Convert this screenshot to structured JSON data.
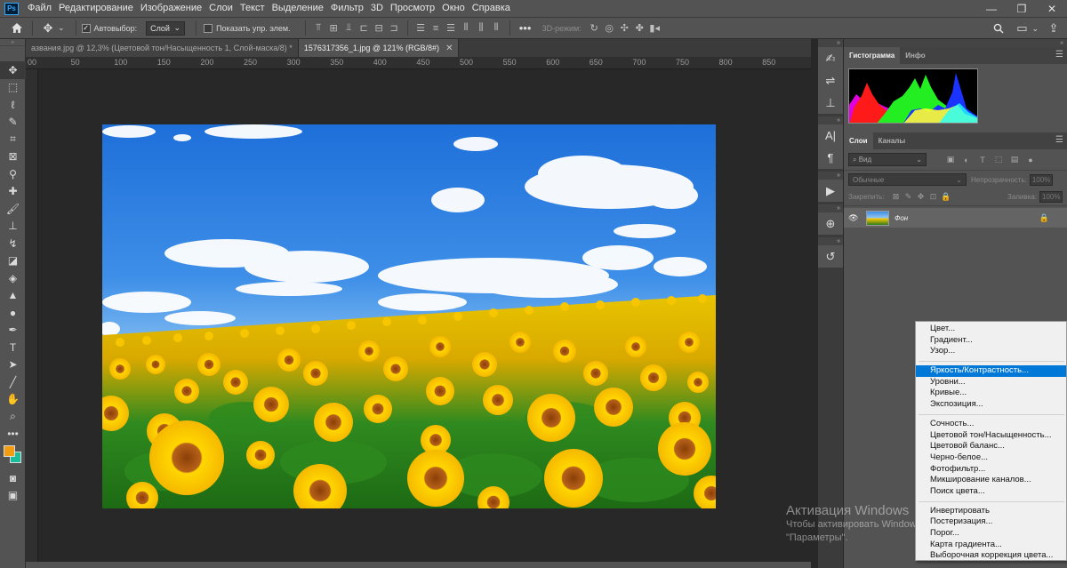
{
  "menubar": {
    "logo": "Ps",
    "items": [
      "Файл",
      "Редактирование",
      "Изображение",
      "Слои",
      "Текст",
      "Выделение",
      "Фильтр",
      "3D",
      "Просмотр",
      "Окно",
      "Справка"
    ],
    "window_controls": [
      "—",
      "❐",
      "✕"
    ]
  },
  "options": {
    "autoselect_label": "Автовыбор:",
    "autoselect_value": "Слой",
    "show_transform_label": "Показать упр. элем.",
    "mode_3d_label": "3D-режим:"
  },
  "tabs": [
    {
      "label": "азвания.jpg @ 12,3% (Цветовой тон/Насыщенность 1, Слой-маска/8) *",
      "active": false
    },
    {
      "label": "1576317356_1.jpg @ 121% (RGB/8#)",
      "active": true
    }
  ],
  "ruler": {
    "top_ticks": [
      "00",
      "50",
      "100",
      "150",
      "200",
      "250",
      "300",
      "350",
      "400",
      "450",
      "500",
      "550",
      "600",
      "650",
      "700",
      "750",
      "800",
      "850"
    ]
  },
  "panels": {
    "histogram_tabs": [
      "Гистограмма",
      "Инфо"
    ],
    "layers_tabs": [
      "Слои",
      "Каналы"
    ],
    "kind_placeholder": "Вид",
    "blend_mode": "Обычные",
    "opacity_label": "Непрозрачность:",
    "opacity_value": "100%",
    "lock_label": "Закрепить:",
    "fill_label": "Заливка:",
    "fill_value": "100%",
    "layer_name": "Фон"
  },
  "context_menu": {
    "groups": [
      [
        "Цвет...",
        "Градиент...",
        "Узор..."
      ],
      [
        "Яркость/Контрастность...",
        "Уровни...",
        "Кривые...",
        "Экспозиция..."
      ],
      [
        "Сочность...",
        "Цветовой тон/Насыщенность...",
        "Цветовой баланс...",
        "Черно-белое...",
        "Фотофильтр...",
        "Микширование каналов...",
        "Поиск цвета..."
      ],
      [
        "Инвертировать",
        "Постеризация...",
        "Порог...",
        "Карта градиента...",
        "Выборочная коррекция цвета..."
      ]
    ],
    "highlighted": "Яркость/Контрастность..."
  },
  "watermark": {
    "title": "Активация Windows",
    "line1": "Чтобы активировать Windows, перейдите в раздел",
    "line2": "\"Параметры\"."
  },
  "colors": {
    "foreground": "#f39c12",
    "background": "#1abc9c",
    "highlight": "#0078d7"
  }
}
